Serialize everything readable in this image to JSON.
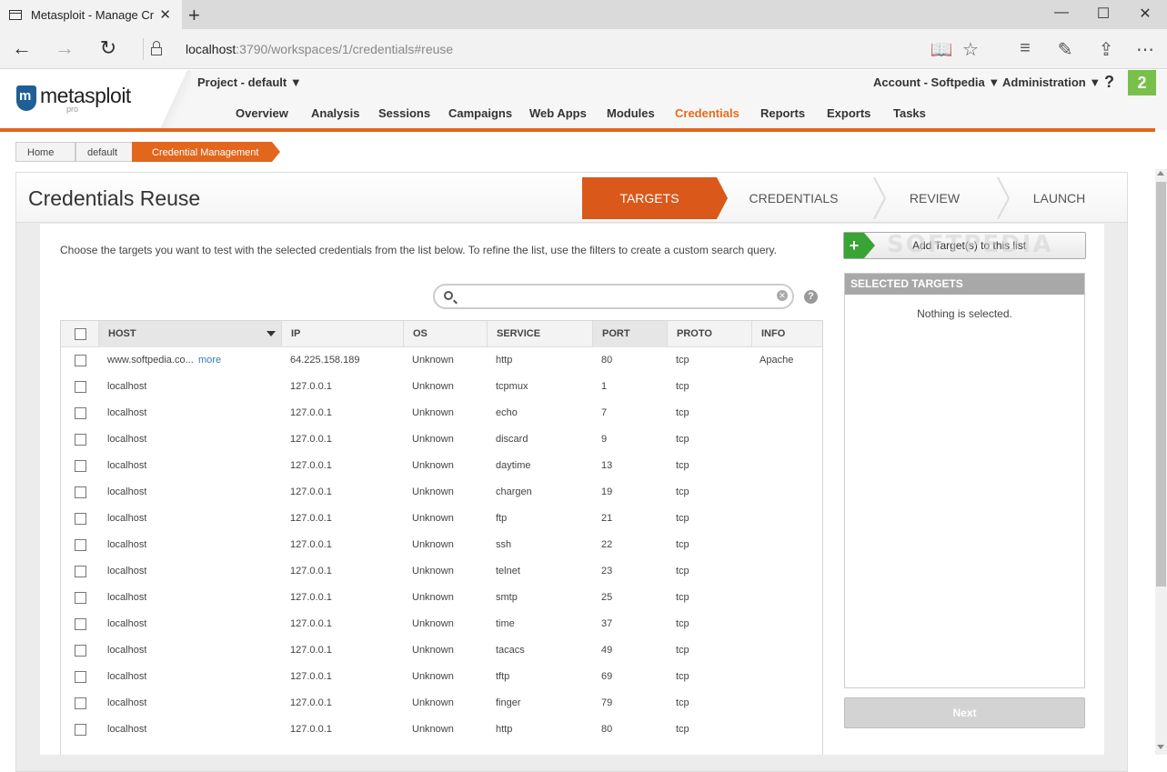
{
  "browser": {
    "tab_title": "Metasploit - Manage Cr",
    "url_host": "localhost",
    "url_rest": ":3790/workspaces/1/credentials#reuse",
    "icons": [
      "back-icon",
      "forward-icon",
      "refresh-icon",
      "lock-icon",
      "reading-view-icon",
      "favorite-star-icon",
      "hub-icon",
      "web-note-icon",
      "share-icon",
      "more-icon"
    ]
  },
  "app": {
    "logo_text": "metasploit",
    "logo_sub": "pro",
    "project_label": "Project - default ▼",
    "account_label": "Account - Softpedia ▼",
    "admin_label": "Administration ▼",
    "help_label": "?",
    "notification_count": "2",
    "menu": [
      "Overview",
      "Analysis",
      "Sessions",
      "Campaigns",
      "Web Apps",
      "Modules",
      "Credentials",
      "Reports",
      "Exports",
      "Tasks"
    ],
    "active_menu": "Credentials",
    "accent_color": "#e2661c"
  },
  "breadcrumb": [
    "Home",
    "default",
    "Credential Management"
  ],
  "page": {
    "title": "Credentials Reuse",
    "steps": [
      "TARGETS",
      "CREDENTIALS",
      "REVIEW",
      "LAUNCH"
    ],
    "active_step": "TARGETS",
    "instructions": "Choose the targets you want to test with the selected credentials from the list below. To refine the list, use the filters to create a custom search query.",
    "search_placeholder": ""
  },
  "table": {
    "columns": [
      "HOST",
      "IP",
      "OS",
      "SERVICE",
      "PORT",
      "PROTO",
      "INFO"
    ],
    "more_label": "more",
    "rows": [
      {
        "host": "www.softpedia.co...",
        "more": true,
        "ip": "64.225.158.189",
        "os": "Unknown",
        "service": "http",
        "port": "80",
        "proto": "tcp",
        "info": "Apache"
      },
      {
        "host": "localhost",
        "ip": "127.0.0.1",
        "os": "Unknown",
        "service": "tcpmux",
        "port": "1",
        "proto": "tcp",
        "info": ""
      },
      {
        "host": "localhost",
        "ip": "127.0.0.1",
        "os": "Unknown",
        "service": "echo",
        "port": "7",
        "proto": "tcp",
        "info": ""
      },
      {
        "host": "localhost",
        "ip": "127.0.0.1",
        "os": "Unknown",
        "service": "discard",
        "port": "9",
        "proto": "tcp",
        "info": ""
      },
      {
        "host": "localhost",
        "ip": "127.0.0.1",
        "os": "Unknown",
        "service": "daytime",
        "port": "13",
        "proto": "tcp",
        "info": ""
      },
      {
        "host": "localhost",
        "ip": "127.0.0.1",
        "os": "Unknown",
        "service": "chargen",
        "port": "19",
        "proto": "tcp",
        "info": ""
      },
      {
        "host": "localhost",
        "ip": "127.0.0.1",
        "os": "Unknown",
        "service": "ftp",
        "port": "21",
        "proto": "tcp",
        "info": ""
      },
      {
        "host": "localhost",
        "ip": "127.0.0.1",
        "os": "Unknown",
        "service": "ssh",
        "port": "22",
        "proto": "tcp",
        "info": ""
      },
      {
        "host": "localhost",
        "ip": "127.0.0.1",
        "os": "Unknown",
        "service": "telnet",
        "port": "23",
        "proto": "tcp",
        "info": ""
      },
      {
        "host": "localhost",
        "ip": "127.0.0.1",
        "os": "Unknown",
        "service": "smtp",
        "port": "25",
        "proto": "tcp",
        "info": ""
      },
      {
        "host": "localhost",
        "ip": "127.0.0.1",
        "os": "Unknown",
        "service": "time",
        "port": "37",
        "proto": "tcp",
        "info": ""
      },
      {
        "host": "localhost",
        "ip": "127.0.0.1",
        "os": "Unknown",
        "service": "tacacs",
        "port": "49",
        "proto": "tcp",
        "info": ""
      },
      {
        "host": "localhost",
        "ip": "127.0.0.1",
        "os": "Unknown",
        "service": "tftp",
        "port": "69",
        "proto": "tcp",
        "info": ""
      },
      {
        "host": "localhost",
        "ip": "127.0.0.1",
        "os": "Unknown",
        "service": "finger",
        "port": "79",
        "proto": "tcp",
        "info": ""
      },
      {
        "host": "localhost",
        "ip": "127.0.0.1",
        "os": "Unknown",
        "service": "http",
        "port": "80",
        "proto": "tcp",
        "info": ""
      }
    ]
  },
  "sidebar": {
    "add_button": "Add Target(s) to this list",
    "watermark": "SOFTPEDIA",
    "selected_header": "SELECTED TARGETS",
    "empty_text": "Nothing is selected.",
    "next_button": "Next"
  }
}
